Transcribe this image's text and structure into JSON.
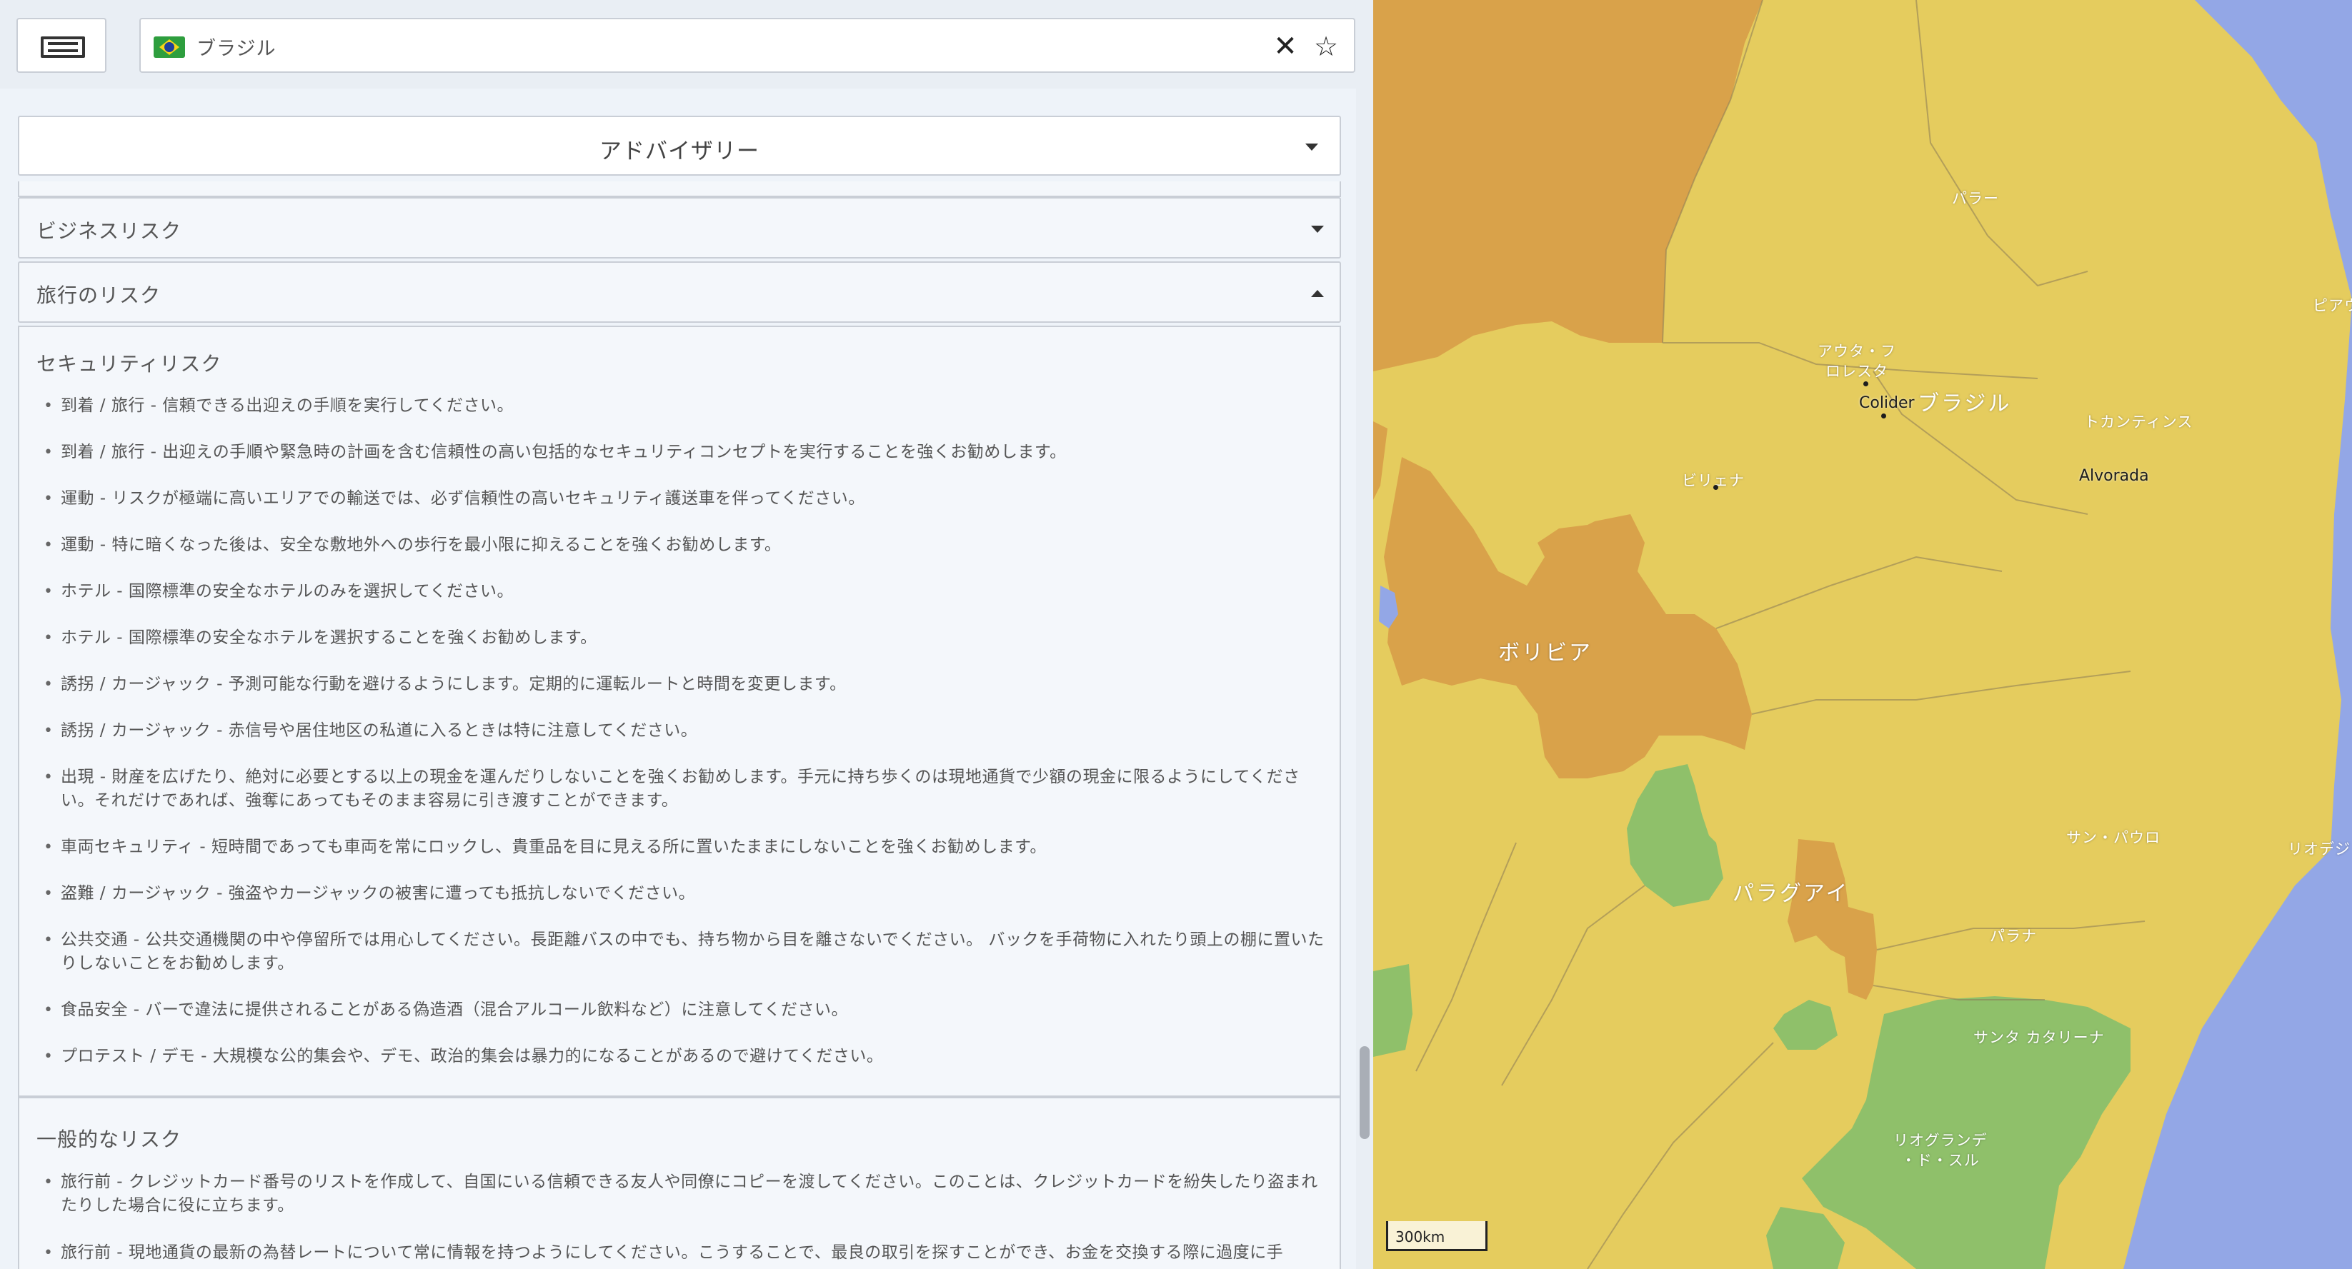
{
  "search": {
    "value": "ブラジル",
    "country": "ブラジル"
  },
  "advisory": {
    "title": "アドバイザリー"
  },
  "sections": {
    "business": "ビジネスリスク",
    "travel": "旅行のリスク"
  },
  "security": {
    "heading": "セキュリティリスク",
    "items": [
      "到着 / 旅行 - 信頼できる出迎えの手順を実行してください。",
      "到着 / 旅行 - 出迎えの手順や緊急時の計画を含む信頼性の高い包括的なセキュリティコンセプトを実行することを強くお勧めします。",
      "運動 - リスクが極端に高いエリアでの輸送では、必ず信頼性の高いセキュリティ護送車を伴ってください。",
      "運動 - 特に暗くなった後は、安全な敷地外への歩行を最小限に抑えることを強くお勧めします。",
      "ホテル - 国際標準の安全なホテルのみを選択してください。",
      "ホテル - 国際標準の安全なホテルを選択することを強くお勧めします。",
      "誘拐 / カージャック - 予測可能な行動を避けるようにします。定期的に運転ルートと時間を変更します。",
      "誘拐 / カージャック - 赤信号や居住地区の私道に入るときは特に注意してください。",
      "出現 - 財産を広げたり、絶対に必要とする以上の現金を運んだりしないことを強くお勧めします。手元に持ち歩くのは現地通貨で少額の現金に限るようにしてください。それだけであれば、強奪にあってもそのまま容易に引き渡すことができます。",
      "車両セキュリティ - 短時間であっても車両を常にロックし、貴重品を目に見える所に置いたままにしないことを強くお勧めします。",
      "盗難 / カージャック - 強盗やカージャックの被害に遭っても抵抗しないでください。",
      "公共交通 - 公共交通機関の中や停留所では用心してください。長距離バスの中でも、持ち物から目を離さないでください。 バックを手荷物に入れたり頭上の棚に置いたりしないことをお勧めします。",
      "食品安全 - バーで違法に提供されることがある偽造酒（混合アルコール飲料など）に注意してください。",
      "プロテスト / デモ - 大規模な公的集会や、デモ、政治的集会は暴力的になることがあるので避けてください。"
    ]
  },
  "general": {
    "heading": "一般的なリスク",
    "items": [
      "旅行前 - クレジットカード番号のリストを作成して、自国にいる信頼できる友人や同僚にコピーを渡してください。このことは、クレジットカードを紛失したり盗まれたりした場合に役に立ちます。",
      "旅行前 - 現地通貨の最新の為替レートについて常に情報を持つようにしてください。こうすることで、最良の取引を探すことができ、お金を交換する際に過度に手"
    ]
  },
  "map": {
    "labels": {
      "para": "パラー",
      "piaui": "ピアウ",
      "alta_floresta": "アウタ・フ\nロレスタ",
      "colider": "Colider",
      "brasil": "ブラジル",
      "tocantins": "トカンティンス",
      "vilhena": "ビリェナ",
      "alvorada": "Alvorada",
      "bolivia": "ボリビア",
      "sao_paulo": "サン・パウロ",
      "rio": "リオデジ",
      "paraguay": "パラグアイ",
      "parana": "パラナ",
      "santa_catarina": "サンタ カタリーナ",
      "rio_grande": "リオグランデ\n・ド・スル"
    },
    "scale": "300km"
  },
  "colors": {
    "high_risk": "#d9a24a",
    "medium_risk": "#e5cc5e",
    "low_risk": "#8fc06a",
    "ocean": "#93a7e6"
  }
}
